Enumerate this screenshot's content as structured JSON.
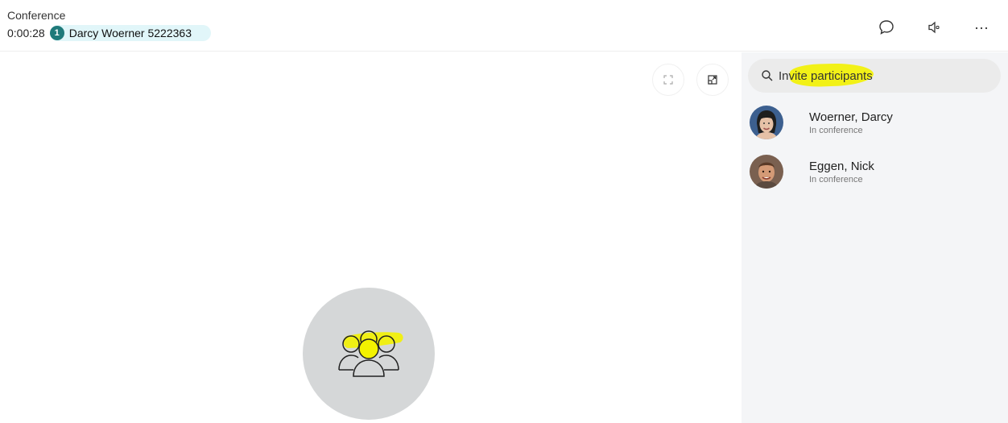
{
  "header": {
    "title": "Conference",
    "timer": "0:00:28",
    "participant_count": "1",
    "call_label": "Darcy Woerner 5222363"
  },
  "icons": {
    "chat": "chat-bubble-icon",
    "speaker": "speaker-icon",
    "more": "more-options-icon",
    "fullscreen": "fullscreen-icon",
    "popout": "popout-icon",
    "search": "search-icon",
    "group": "group-icon"
  },
  "search": {
    "placeholder": "Invite participants"
  },
  "participants": [
    {
      "name": "Woerner, Darcy",
      "status": "In conference"
    },
    {
      "name": "Eggen, Nick",
      "status": "In conference"
    }
  ],
  "colors": {
    "accent_teal": "#1f7a7a",
    "chip_bg": "#e1f6f9",
    "highlight": "#f3f200",
    "panel_bg": "#f4f5f7",
    "avatar_bg": "#d5d7d8"
  }
}
